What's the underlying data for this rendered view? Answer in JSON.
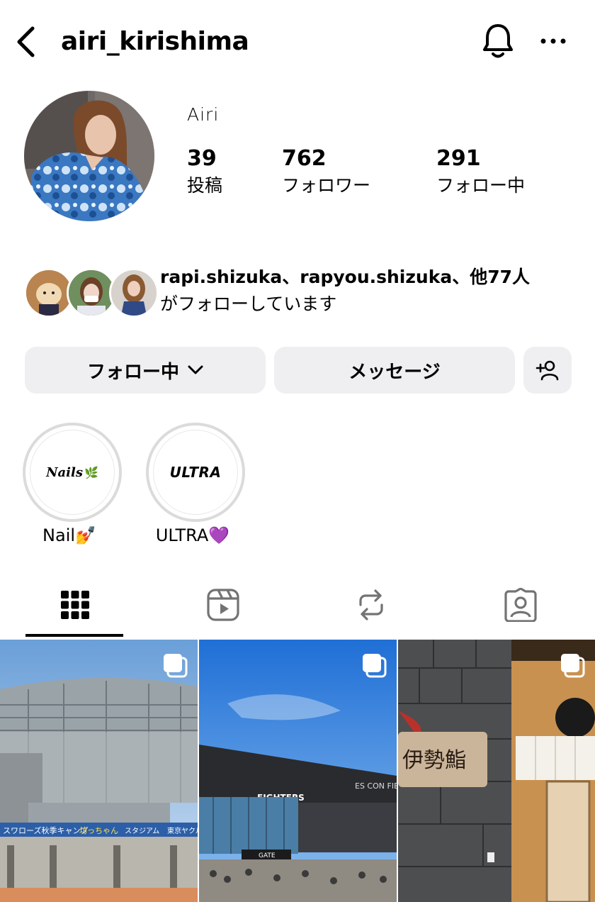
{
  "header": {
    "username": "airi_kirishima"
  },
  "profile": {
    "display_name": "Airi",
    "stats": [
      {
        "value": "39",
        "label": "投稿"
      },
      {
        "value": "762",
        "label": "フォロワー"
      },
      {
        "value": "291",
        "label": "フォロー中"
      }
    ]
  },
  "followed_by": {
    "names": "rapi.shizuka、rapyou.shizuka",
    "rest": "、他77人",
    "line2": "がフォローしています"
  },
  "actions": {
    "following_label": "フォロー中",
    "message_label": "メッセージ"
  },
  "highlights": [
    {
      "label": "Nail💅",
      "cover_text": "Nails"
    },
    {
      "label": "ULTRA💜",
      "cover_text": "ULTRA"
    }
  ],
  "posts": [
    {
      "subject": "stadium",
      "signs": [
        "スワローズ秋季キャンプ",
        "坊っちゃん",
        "スタジアム",
        "東京ヤクル"
      ]
    },
    {
      "subject": "es-con-field",
      "signs": [
        "FIGHTERS",
        "ES CON FIE",
        "GATE"
      ]
    },
    {
      "subject": "restaurant",
      "signs": [
        "伊勢鮨"
      ]
    }
  ],
  "colors": {
    "button_bg": "#efeff2",
    "ring": "#dbdbdb",
    "heart_purple": "#a24df0"
  }
}
